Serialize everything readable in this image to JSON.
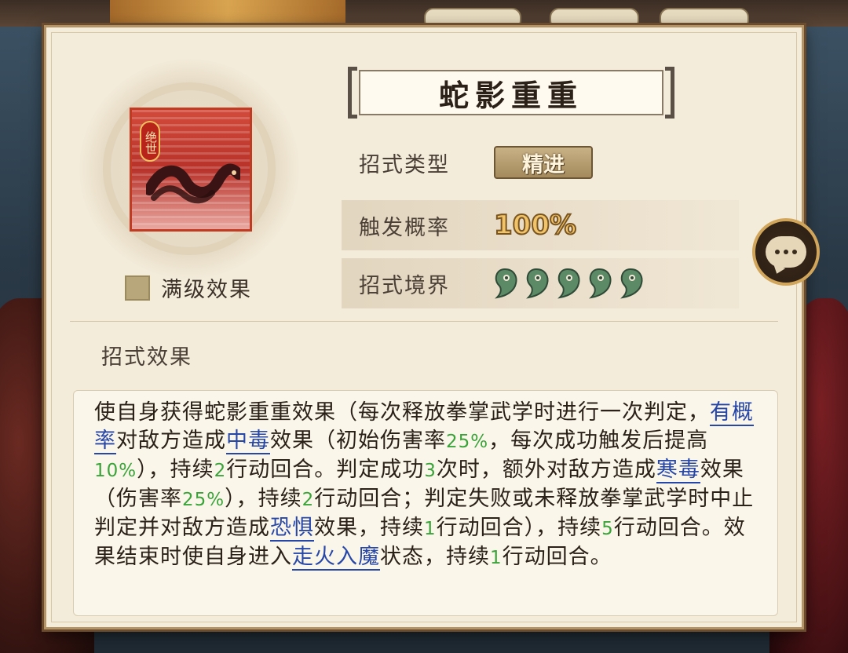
{
  "skill": {
    "name": "蛇影重重",
    "tag": "绝世",
    "icon": "snake-icon",
    "max_level_label": "满级效果"
  },
  "attributes": {
    "type_label": "招式类型",
    "type_value": "精进",
    "trigger_label": "触发概率",
    "trigger_value": "100%",
    "realm_label": "招式境界",
    "realm_level": 5
  },
  "effect": {
    "heading": "招式效果",
    "segments": [
      {
        "t": "使自身获得蛇影重重效果（每次释放拳掌武学时进行一次判定，"
      },
      {
        "t": "有概率",
        "k": "link"
      },
      {
        "t": "对敌方造成"
      },
      {
        "t": "中毒",
        "k": "link"
      },
      {
        "t": "效果（初始伤害率"
      },
      {
        "t": "25%",
        "k": "num"
      },
      {
        "t": "，每次成功触发后提高"
      },
      {
        "t": "10%",
        "k": "num"
      },
      {
        "t": "），持续"
      },
      {
        "t": "2",
        "k": "num"
      },
      {
        "t": "行动回合。判定成功"
      },
      {
        "t": "3",
        "k": "num"
      },
      {
        "t": "次时，额外对敌方造成"
      },
      {
        "t": "寒毒",
        "k": "link"
      },
      {
        "t": "效果（伤害率"
      },
      {
        "t": "25%",
        "k": "num"
      },
      {
        "t": "），持续"
      },
      {
        "t": "2",
        "k": "num"
      },
      {
        "t": "行动回合；判定失败或未释放拳掌武学时中止判定并对敌方造成"
      },
      {
        "t": "恐惧",
        "k": "link"
      },
      {
        "t": "效果，持续"
      },
      {
        "t": "1",
        "k": "num"
      },
      {
        "t": "行动回合），持续"
      },
      {
        "t": "5",
        "k": "num"
      },
      {
        "t": "行动回合。效果结束时使自身进入"
      },
      {
        "t": "走火入魔",
        "k": "link"
      },
      {
        "t": "状态，持续"
      },
      {
        "t": "1",
        "k": "num"
      },
      {
        "t": "行动回合。"
      }
    ]
  },
  "icons": {
    "chat": "chat-bubble-icon",
    "realm": "magatama-icon",
    "checkbox": "checkbox-icon"
  },
  "colors": {
    "link": "#2747a8",
    "number": "#3aa33a",
    "panel_bg": "#f4ecdb"
  }
}
